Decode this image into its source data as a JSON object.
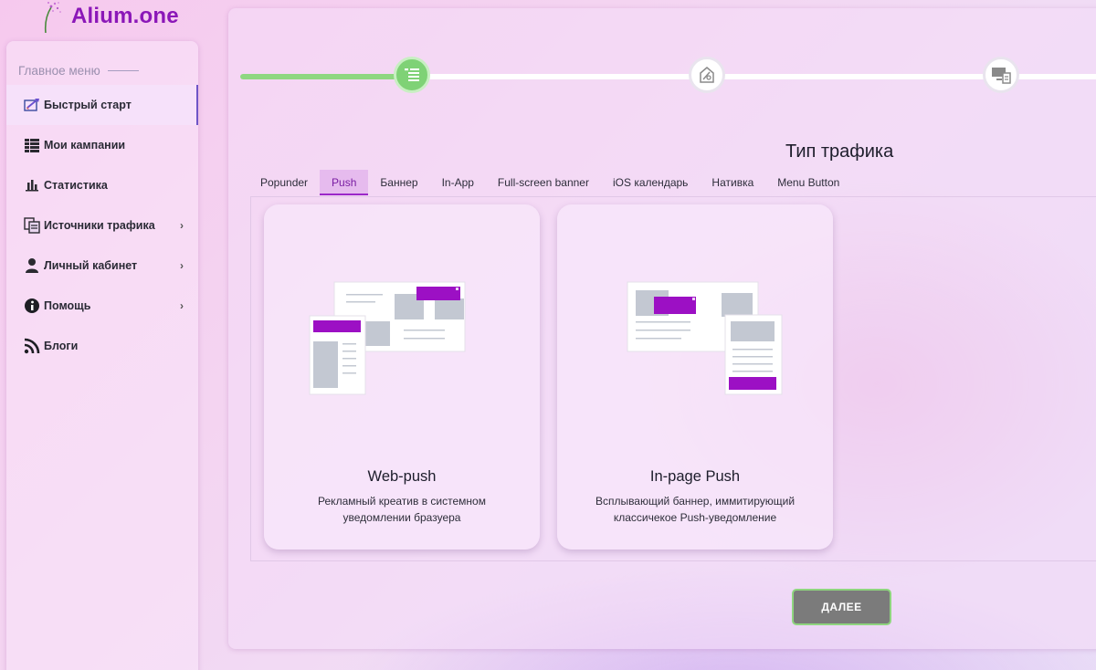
{
  "app": {
    "logo_text": "Alium.one"
  },
  "sidebar": {
    "header": "Главное меню",
    "items": [
      {
        "label": "Быстрый старт",
        "icon": "rocket-icon",
        "active": true
      },
      {
        "label": "Мои кампании",
        "icon": "campaigns-icon"
      },
      {
        "label": "Статистика",
        "icon": "bar-chart-icon"
      },
      {
        "label": "Источники трафика",
        "icon": "traffic-sources-icon",
        "has_submenu": true
      },
      {
        "label": "Личный кабинет",
        "icon": "user-icon",
        "has_submenu": true
      },
      {
        "label": "Помощь",
        "icon": "info-icon",
        "has_submenu": true
      },
      {
        "label": "Блоги",
        "icon": "rss-icon"
      }
    ]
  },
  "stepper": {
    "steps": [
      {
        "icon": "list-icon",
        "state": "current"
      },
      {
        "icon": "design-icon",
        "state": "upcoming"
      },
      {
        "icon": "devices-icon",
        "state": "upcoming"
      }
    ]
  },
  "main": {
    "title": "Тип трафика",
    "tabs": [
      {
        "label": "Popunder"
      },
      {
        "label": "Push",
        "active": true
      },
      {
        "label": "Баннер"
      },
      {
        "label": "In-App"
      },
      {
        "label": "Full-screen banner"
      },
      {
        "label": "iOS календарь"
      },
      {
        "label": "Нативка"
      },
      {
        "label": "Menu Button"
      }
    ],
    "cards": [
      {
        "title": "Web-push",
        "description": "Рекламный креатив в системном уведомлении бразуера"
      },
      {
        "title": "In-page Push",
        "description": "Всплывающий баннер, иммитирующий классичекое Push-уведомление"
      }
    ],
    "next_label": "ДАЛЕЕ"
  },
  "colors": {
    "brand": "#8b17b8",
    "accent_purple": "#9c10c4",
    "progress_green": "#7fd276",
    "button_gray": "#7b7b7b",
    "placeholder_gray": "#c3c8d2"
  }
}
